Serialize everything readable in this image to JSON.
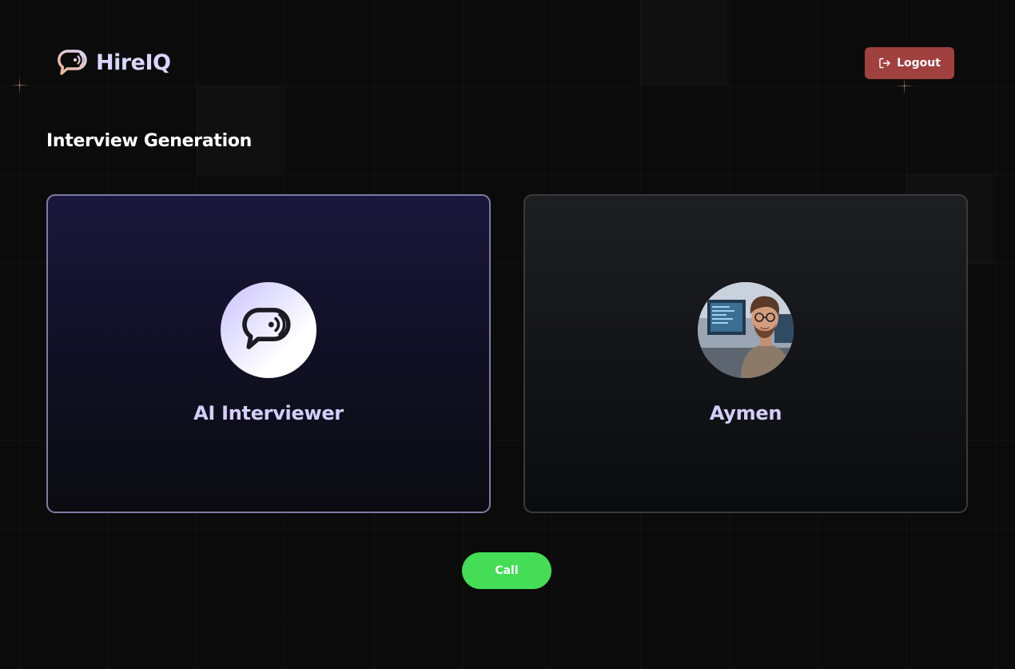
{
  "header": {
    "brand": "HireIQ",
    "logo_icon": "chat-bubble-signal-icon",
    "logout_label": "Logout",
    "logout_icon": "logout-icon"
  },
  "page": {
    "title": "Interview Generation"
  },
  "participants": {
    "ai": {
      "label": "AI Interviewer",
      "icon": "chat-bubble-signal-icon"
    },
    "user": {
      "label": "Aymen",
      "avatar": "user-photo"
    }
  },
  "actions": {
    "call_label": "Call"
  },
  "colors": {
    "background": "#0b0b0b",
    "brand_text": "#d9d6ff",
    "logout_bg": "#a0403f",
    "call_bg": "#44dd55",
    "ai_card_border": "#7f7aa6",
    "user_card_border": "#3a3a3c",
    "card_label": "#d2cffa",
    "logo_gradient_start": "#f2b58a",
    "logo_gradient_end": "#d9d6ff"
  }
}
